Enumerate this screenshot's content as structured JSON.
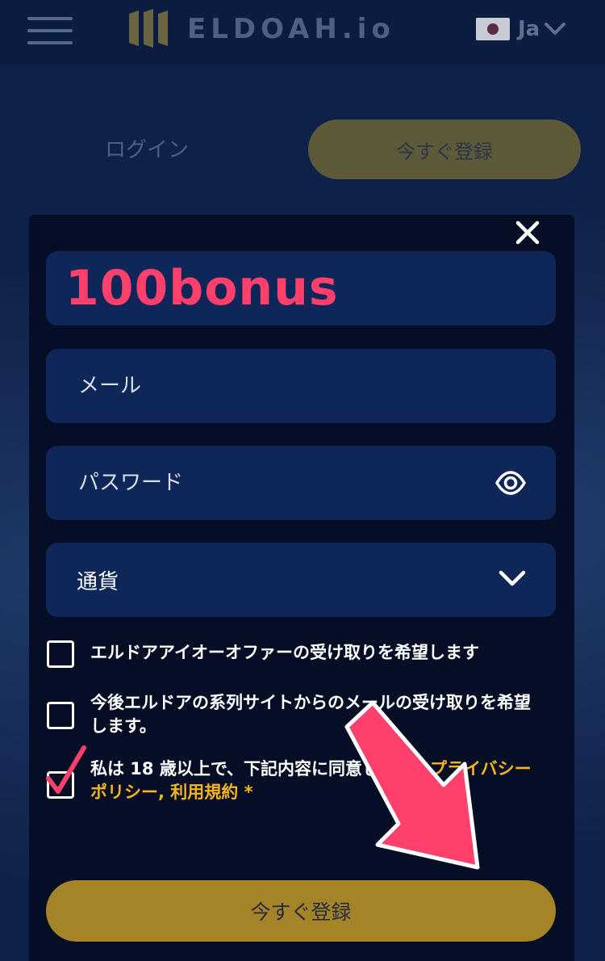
{
  "header": {
    "logo_text": "ELDOAH.io",
    "language": {
      "label": "Ja",
      "flag": "japan-flag"
    }
  },
  "auth": {
    "login_label": "ログイン",
    "register_label": "今すぐ登録"
  },
  "form": {
    "promo_code_value": "100bonus",
    "email_placeholder": "メール",
    "password_placeholder": "パスワード",
    "currency_label": "通貨",
    "checkboxes": [
      {
        "text": "エルドアアイオーオファーの受け取りを希望します",
        "checked": false
      },
      {
        "text": "今後エルドアの系列サイトからのメールの受け取りを希望します。",
        "checked": false
      },
      {
        "text_prefix": "私は 18 歳以上で、下記内容に同意します：",
        "link_1": "プライバシーポリシー",
        "separator": ", ",
        "link_2": "利用規約",
        "required_mark": " *",
        "checked": true
      }
    ],
    "submit_label": "今すぐ登録"
  },
  "colors": {
    "accent": "#f5b51f",
    "promo_text": "#ff3f6c",
    "annotation": "#ff3f6c",
    "submit_button": "#a58427",
    "modal_background": "#050e24",
    "field_background": "#0f2658"
  },
  "icons": {
    "menu": "hamburger-icon",
    "close": "close-icon",
    "password_toggle": "eye-icon",
    "dropdown": "chevron-down-icon"
  }
}
